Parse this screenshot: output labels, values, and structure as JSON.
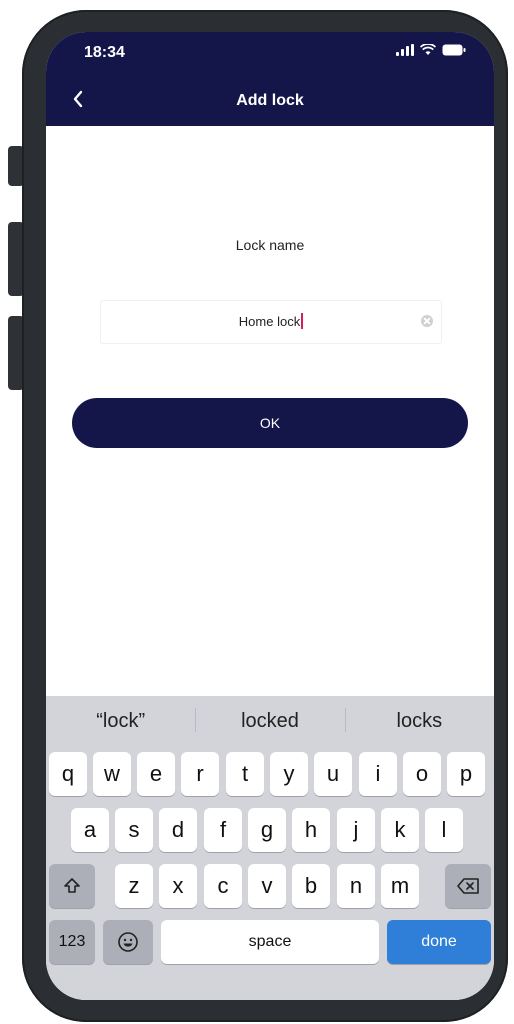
{
  "status_bar": {
    "time": "18:34"
  },
  "nav": {
    "title": "Add lock"
  },
  "form": {
    "label": "Lock name",
    "input_value": "Home lock",
    "ok_label": "OK"
  },
  "keyboard": {
    "suggestions": [
      "“lock”",
      "locked",
      "locks"
    ],
    "row1": [
      "q",
      "w",
      "e",
      "r",
      "t",
      "y",
      "u",
      "i",
      "o",
      "p"
    ],
    "row2": [
      "a",
      "s",
      "d",
      "f",
      "g",
      "h",
      "j",
      "k",
      "l"
    ],
    "row3": [
      "z",
      "x",
      "c",
      "v",
      "b",
      "n",
      "m"
    ],
    "numbers_label": "123",
    "space_label": "space",
    "done_label": "done"
  },
  "colors": {
    "nav_background": "#14164a",
    "done_key": "#2f7ed8",
    "caret": "#d81b60"
  }
}
